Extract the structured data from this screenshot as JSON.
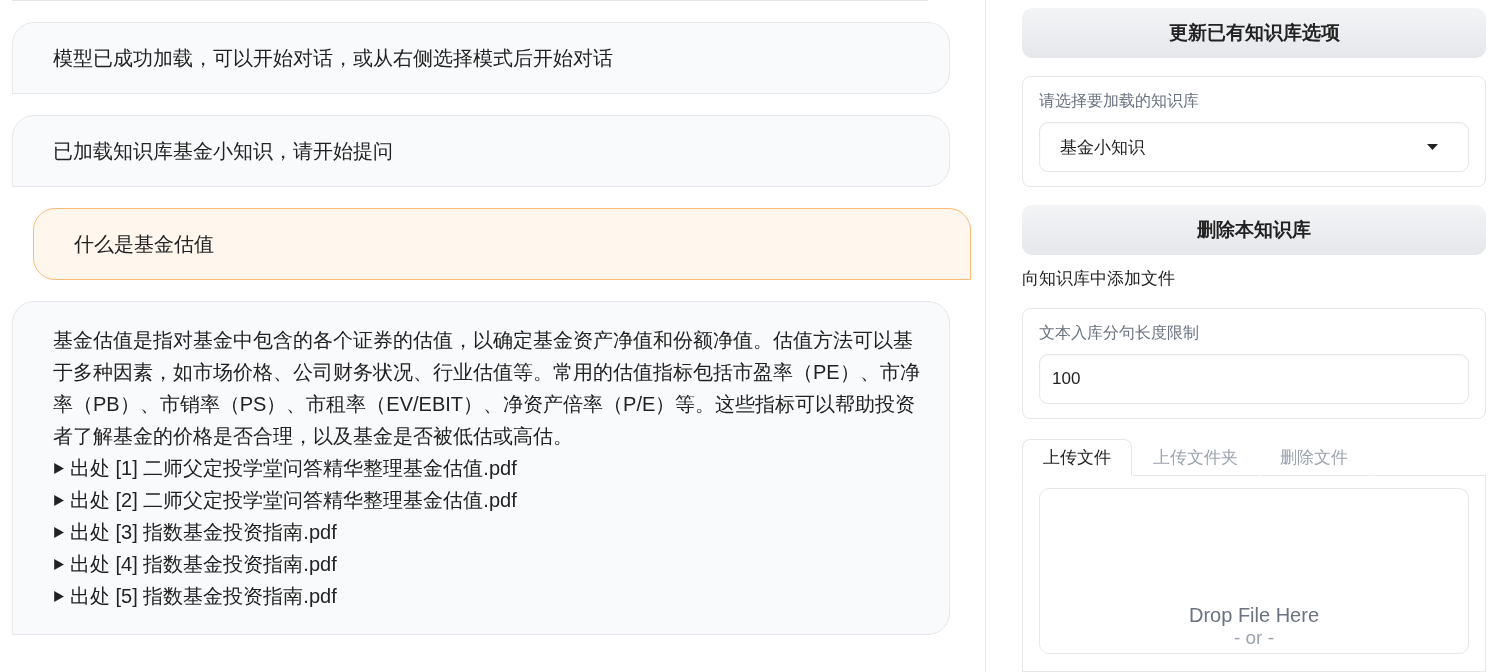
{
  "chat": {
    "messages": [
      {
        "kind": "bot",
        "text": "模型已成功加载，可以开始对话，或从右侧选择模式后开始对话"
      },
      {
        "kind": "bot",
        "text": "已加载知识库基金小知识，请开始提问"
      },
      {
        "kind": "user",
        "text": "什么是基金估值"
      },
      {
        "kind": "bot",
        "text": "基金估值是指对基金中包含的各个证券的估值，以确定基金资产净值和份额净值。估值方法可以基于多种因素，如市场价格、公司财务状况、行业估值等。常用的估值指标包括市盈率（PE）、市净率（PB）、市销率（PS）、市租率（EV/EBIT）、净资产倍率（P/E）等。这些指标可以帮助投资者了解基金的价格是否合理，以及基金是否被低估或高估。",
        "sources": [
          {
            "label": "出处 [1] 二师父定投学堂问答精华整理基金估值.pdf",
            "expanded": false
          },
          {
            "label": "出处 [2] 二师父定投学堂问答精华整理基金估值.pdf",
            "expanded": false
          },
          {
            "label": "出处 [3] 指数基金投资指南.pdf",
            "expanded": false
          },
          {
            "label": "出处 [4] 指数基金投资指南.pdf",
            "expanded": false
          },
          {
            "label": "出处 [5] 指数基金投资指南.pdf",
            "expanded": false
          }
        ]
      }
    ]
  },
  "sidebar": {
    "update_button": "更新已有知识库选项",
    "kb_select": {
      "label": "请选择要加载的知识库",
      "value": "基金小知识"
    },
    "delete_button": "删除本知识库",
    "add_files_label": "向知识库中添加文件",
    "chunk_field": {
      "label": "文本入库分句长度限制",
      "value": "100"
    },
    "tabs": [
      {
        "label": "上传文件",
        "selected": true
      },
      {
        "label": "上传文件夹",
        "selected": false
      },
      {
        "label": "删除文件",
        "selected": false
      }
    ],
    "dropzone": {
      "title": "Drop File Here",
      "subtitle": "- or -"
    }
  }
}
